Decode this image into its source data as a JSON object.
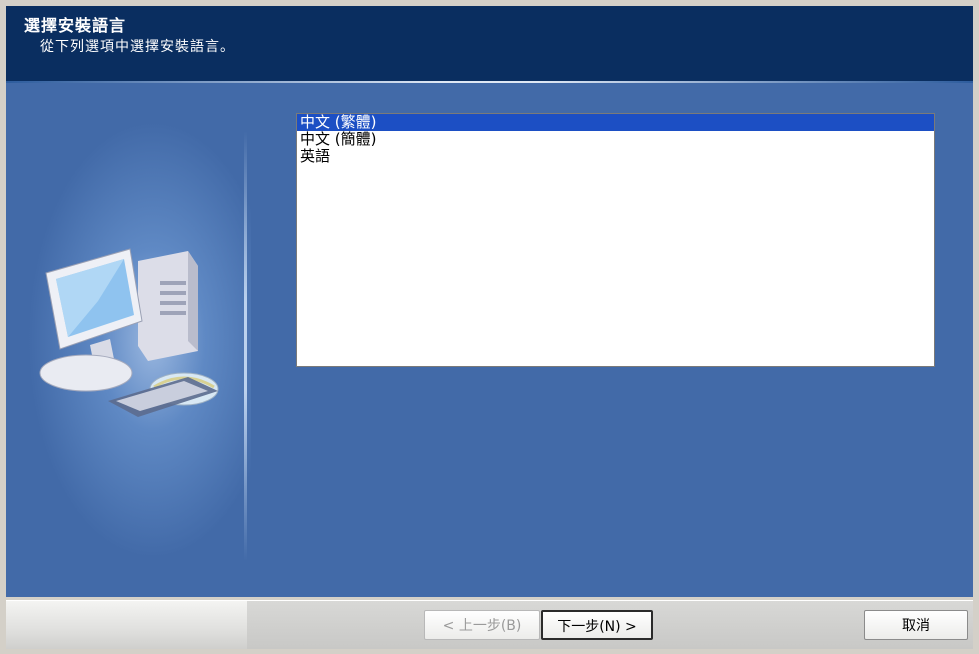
{
  "header": {
    "title": "選擇安裝語言",
    "subtitle": "從下列選項中選擇安裝語言。"
  },
  "language_list": {
    "items": [
      {
        "label": "中文 (繁體)",
        "selected": true
      },
      {
        "label": "中文 (簡體)",
        "selected": false
      },
      {
        "label": "英語",
        "selected": false
      }
    ]
  },
  "buttons": {
    "back": "< 上一步(B)",
    "next": "下一步(N) >",
    "cancel": "取消"
  },
  "colors": {
    "header_bg": "#0a2e60",
    "body_bg": "#426aa8",
    "selection": "#1c4fc4"
  }
}
